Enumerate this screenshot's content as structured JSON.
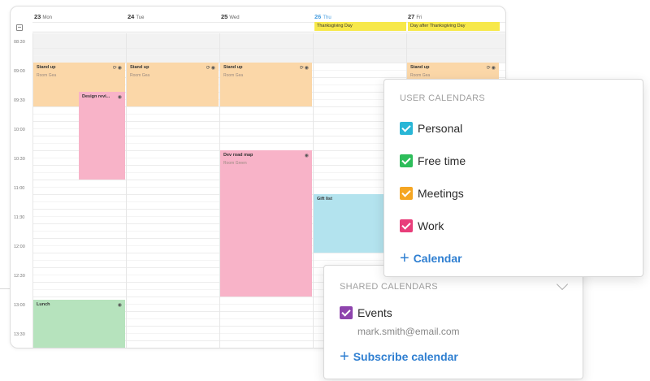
{
  "days": [
    {
      "num": "23",
      "wk": "Mon"
    },
    {
      "num": "24",
      "wk": "Tue"
    },
    {
      "num": "25",
      "wk": "Wed"
    },
    {
      "num": "26",
      "wk": "Thu"
    },
    {
      "num": "27",
      "wk": "Fri"
    }
  ],
  "holidays": [
    "Thanksgiving Day",
    "Day after Thanksgiving Day"
  ],
  "times": [
    "08:30",
    "09:00",
    "09:30",
    "10:00",
    "10:30",
    "11:00",
    "11:30",
    "12:00",
    "12:30",
    "13:00",
    "13:30"
  ],
  "events": {
    "standup_title": "Stand up",
    "standup_room": "Room Gea",
    "design_review": "Design revi...",
    "dev_roadmap": "Dev road map",
    "dev_roadmap_room": "Room Green",
    "gift_list": "Gift list",
    "lunch": "Lunch"
  },
  "user_calendars": {
    "title": "USER CALENDARS",
    "items": [
      {
        "label": "Personal",
        "color": "#29b6d6"
      },
      {
        "label": "Free time",
        "color": "#2dbd5a"
      },
      {
        "label": "Meetings",
        "color": "#f5a623"
      },
      {
        "label": "Work",
        "color": "#e83e7a"
      }
    ],
    "add_label": "Calendar"
  },
  "shared_calendars": {
    "title": "SHARED CALENDARS",
    "items": [
      {
        "label": "Events",
        "color": "#8e44ad",
        "owner": "mark.smith@email.com"
      }
    ],
    "add_label": "Subscribe calendar"
  }
}
